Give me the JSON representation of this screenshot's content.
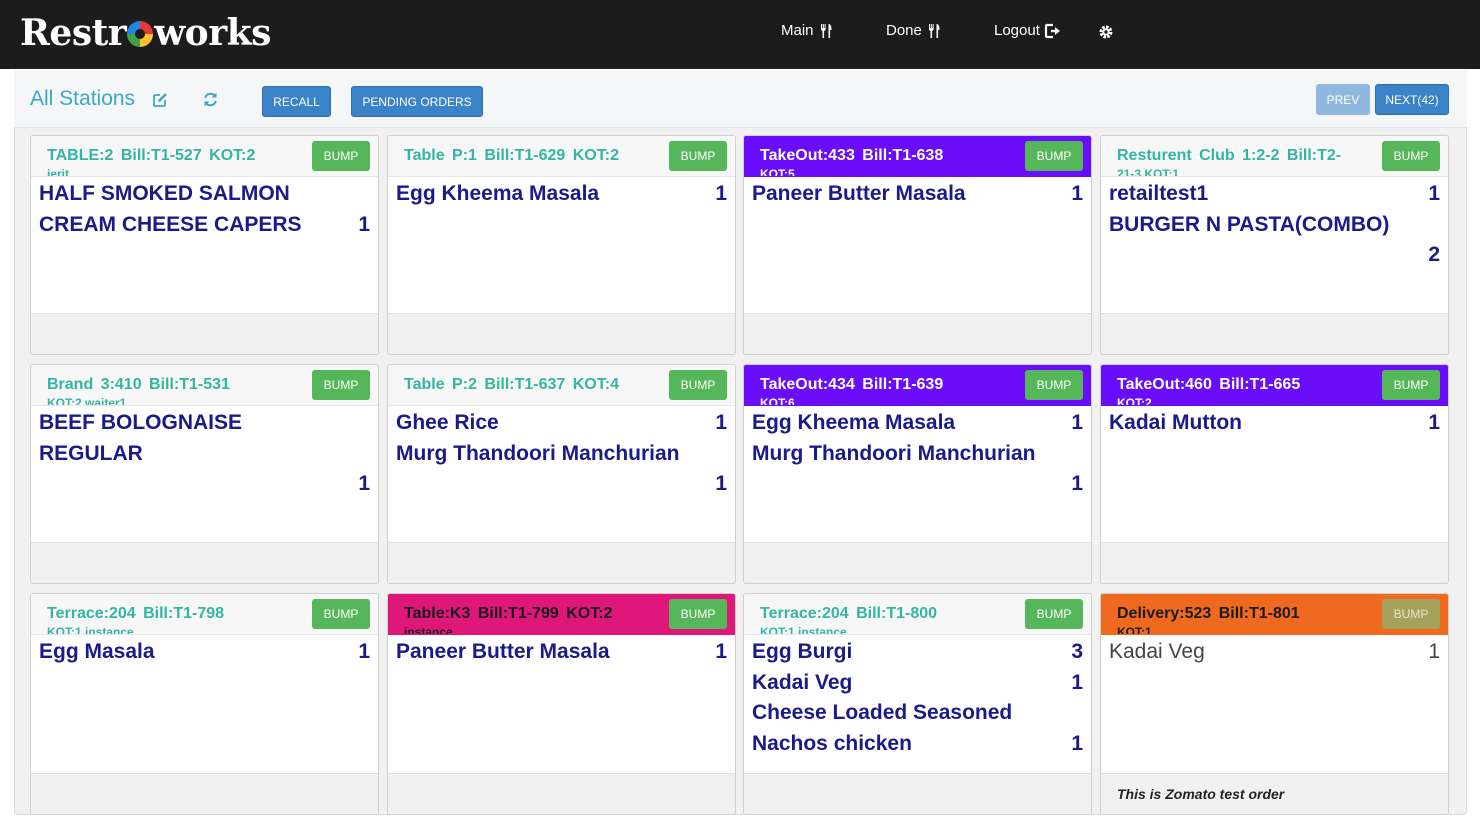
{
  "app": {
    "logo": "Restroworks",
    "logo_parts": [
      "Restr",
      "works"
    ],
    "nav": [
      {
        "label": "Main"
      },
      {
        "label": "Done"
      },
      {
        "label": "Logout"
      }
    ]
  },
  "toolbar": {
    "station": "All Stations",
    "recall": "RECALL",
    "pending": "PENDING ORDERS",
    "prev": "PREV",
    "next": "NEXT(42)"
  },
  "colors": {
    "teal": "#33b5a5",
    "purple": "#6a0dfa",
    "pink": "#e0177a",
    "orange": "#ef6a1e",
    "item_text": "#1a1a8a",
    "bump_green": "#55b75a"
  },
  "orders": [
    {
      "header": "TABLE:2 Bill:T1-527 KOT:2",
      "sub": "jerit",
      "bump": "BUMP",
      "items": [
        {
          "name": "HALF SMOKED SALMON CREAM CHEESE CAPERS",
          "qty": "1"
        }
      ]
    },
    {
      "header": "Table P:1 Bill:T1-629 KOT:2",
      "sub": "",
      "bump": "BUMP",
      "items": [
        {
          "name": "Egg Kheema Masala",
          "qty": "1"
        }
      ]
    },
    {
      "header": "TakeOut:433 Bill:T1-638",
      "sub": "KOT:5",
      "bump": "BUMP",
      "items": [
        {
          "name": "Paneer Butter Masala",
          "qty": "1"
        }
      ]
    },
    {
      "header": "Resturent Club 1:2-2 Bill:T2-",
      "sub": "21-3 KOT:1",
      "bump": "BUMP",
      "items": [
        {
          "name": "retailtest1",
          "qty": "1"
        },
        {
          "name": "BURGER N PASTA(COMBO)",
          "qty": ""
        }
      ],
      "extra_qty": "2"
    },
    {
      "header": "Brand 3:410 Bill:T1-531",
      "sub": "KOT:2 waiter1",
      "bump": "BUMP",
      "items": [
        {
          "name": "BEEF BOLOGNAISE REGULAR",
          "qty": ""
        }
      ],
      "extra_qty": "1"
    },
    {
      "header": "Table P:2 Bill:T1-637 KOT:4",
      "sub": "",
      "bump": "BUMP",
      "items": [
        {
          "name": "Ghee Rice",
          "qty": "1"
        },
        {
          "name": "Murg Thandoori Manchurian",
          "qty": ""
        }
      ],
      "extra_qty": "1"
    },
    {
      "header": "TakeOut:434 Bill:T1-639",
      "sub": "KOT:6",
      "bump": "BUMP",
      "items": [
        {
          "name": "Egg Kheema Masala",
          "qty": "1"
        },
        {
          "name": "Murg Thandoori Manchurian",
          "qty": ""
        }
      ],
      "extra_qty": "1"
    },
    {
      "header": "TakeOut:460 Bill:T1-665",
      "sub": "KOT:2",
      "bump": "BUMP",
      "items": [
        {
          "name": "Kadai Mutton",
          "qty": "1"
        }
      ]
    },
    {
      "header": "Terrace:204 Bill:T1-798",
      "sub": "KOT:1 instance",
      "bump": "BUMP",
      "items": [
        {
          "name": "Egg Masala",
          "qty": "1"
        }
      ]
    },
    {
      "header": "Table:K3 Bill:T1-799 KOT:2",
      "sub": "instance",
      "bump": "BUMP",
      "items": [
        {
          "name": "Paneer Butter Masala",
          "qty": "1"
        }
      ]
    },
    {
      "header": "Terrace:204 Bill:T1-800",
      "sub": "KOT:1 instance",
      "bump": "BUMP",
      "items": [
        {
          "name": "Egg Burgi",
          "qty": "3"
        },
        {
          "name": "Kadai Veg",
          "qty": "1"
        },
        {
          "name": "Cheese Loaded Seasoned Nachos chicken",
          "qty": "1"
        }
      ]
    },
    {
      "header": "Delivery:523 Bill:T1-801",
      "sub": "KOT:1",
      "bump": "BUMP",
      "items": [
        {
          "name": "Kadai Veg",
          "qty": "1"
        }
      ],
      "note": "This is Zomato test order"
    }
  ]
}
